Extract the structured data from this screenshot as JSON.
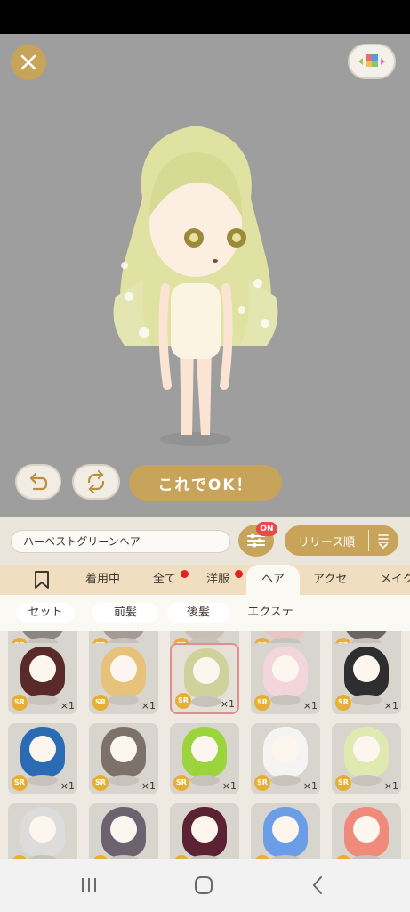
{
  "colors": {
    "accent": "#c8a35a",
    "stage": "#9e9e9e",
    "tab_bar": "#f1ddbf",
    "notice_dot": "#e32020",
    "sr_badge": "#e6ae37",
    "selected_border": "#e08f8f"
  },
  "toolbar": {
    "close_icon": "close-icon",
    "layout_icon": "color-blocks-icon",
    "undo_icon": "undo-icon",
    "swap_icon": "swap-icon",
    "ok_label": "これでOK！"
  },
  "search": {
    "item_name": "ハーベストグリーンヘア",
    "filter_badge": "ON",
    "sort_label": "リリース順"
  },
  "tabs": [
    {
      "label": "",
      "icon": "bookmark-icon"
    },
    {
      "label": "着用中"
    },
    {
      "label": "全て",
      "notice": true
    },
    {
      "label": "洋服",
      "notice": true
    },
    {
      "label": "ヘア",
      "active": true
    },
    {
      "label": "アクセ"
    },
    {
      "label": "メイク"
    }
  ],
  "sub_tabs": [
    {
      "label": "セット"
    },
    {
      "label": "前髪"
    },
    {
      "label": "後髪"
    },
    {
      "label": "エクステ"
    }
  ],
  "grid": {
    "rarity": "SR",
    "rows": [
      [
        {
          "hair": "#8a8680",
          "count": "×1"
        },
        {
          "hair": "#a39c94",
          "count": "×1"
        },
        {
          "hair": "#c8c0b4",
          "count": "×1"
        },
        {
          "hair": "#e8c6c6",
          "count": "×1"
        },
        {
          "hair": "#6a6560",
          "count": "×1"
        }
      ],
      [
        {
          "hair": "#5a2a2a",
          "count": "×1"
        },
        {
          "hair": "#e6c27a",
          "count": "×1"
        },
        {
          "hair": "#cfd29a",
          "count": "×1",
          "selected": true
        },
        {
          "hair": "#f2d6dc",
          "count": "×1"
        },
        {
          "hair": "#2e2e30",
          "count": "×1"
        }
      ],
      [
        {
          "hair": "#2a6bb3",
          "count": "×1"
        },
        {
          "hair": "#7c726a",
          "count": "×1"
        },
        {
          "hair": "#9bd43c",
          "count": "×1"
        },
        {
          "hair": "#f6f4f2",
          "count": "×1"
        },
        {
          "hair": "#dfe9b0",
          "count": "×1"
        }
      ],
      [
        {
          "hair": "#dcdcdc",
          "count": ""
        },
        {
          "hair": "#6c6270",
          "count": ""
        },
        {
          "hair": "#5a2232",
          "count": ""
        },
        {
          "hair": "#6b9ee6",
          "count": ""
        },
        {
          "hair": "#f08a7a",
          "count": ""
        }
      ]
    ]
  },
  "nav": {
    "recent_icon": "recent-apps-icon",
    "home_icon": "home-icon",
    "back_icon": "back-icon"
  }
}
